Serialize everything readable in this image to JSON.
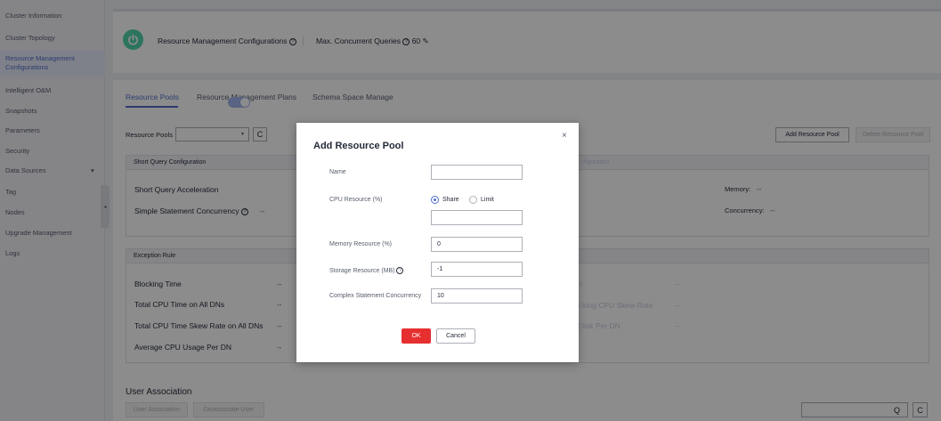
{
  "sidebar": {
    "items": [
      {
        "label": "Cluster Information"
      },
      {
        "label": "Cluster Topology"
      },
      {
        "label": "Resource Management"
      },
      {
        "label": "Configurations"
      },
      {
        "label": "Intelligent O&M"
      },
      {
        "label": "Snapshots"
      },
      {
        "label": "Parameters"
      },
      {
        "label": "Security"
      },
      {
        "label": "Data Sources"
      },
      {
        "label": "Tag"
      },
      {
        "label": "Nodes"
      },
      {
        "label": "Upgrade Management"
      },
      {
        "label": "Logs"
      }
    ],
    "data_sources_arrow": "▾",
    "collapse_arrow": "◂"
  },
  "top": {
    "rm_config_label": "Resource Management Configurations",
    "max_queries_label": "Max. Concurrent Queries",
    "max_queries_value": "60",
    "help_glyph": "?",
    "edit_glyph": "✎"
  },
  "tabs": [
    {
      "label": "Resource Pools"
    },
    {
      "label": "Resource Management Plans"
    },
    {
      "label": "Schema Space Manage"
    }
  ],
  "pools": {
    "label": "Resource Pools",
    "select_caret": "▾",
    "refresh_glyph": "C",
    "add_button": "Add Resource Pool",
    "delete_button": "Delete Resource Pool"
  },
  "short_query": {
    "header": "Short Query Configuration",
    "acceleration_label": "Short Query Acceleration",
    "simple_concurrency_label": "Simple Statement Concurrency",
    "simple_concurrency_value": "--"
  },
  "right_config": {
    "header": "nfiguration",
    "dash1": "--",
    "dash2": "--",
    "memory_label": "Memory:",
    "memory_value": "--",
    "concurrency_label": "Concurrency:",
    "concurrency_value": "--"
  },
  "exception": {
    "header": "Exception Rule",
    "rows": [
      {
        "label": "Blocking Time",
        "value": "--"
      },
      {
        "label": "Total CPU Time on All DNs",
        "value": "--"
      },
      {
        "label": "Total CPU Time Skew Rate on All DNs",
        "value": "--"
      },
      {
        "label": "Average CPU Usage Per DN",
        "value": "--"
      }
    ],
    "right_rows": [
      {
        "label": "e",
        "value": "--"
      },
      {
        "label": "cking CPU Skew Rate",
        "value": "--"
      },
      {
        "label": "Disk Per DN",
        "value": "--"
      }
    ]
  },
  "user_association": {
    "title": "User Association",
    "assoc_button": "User Association",
    "disassoc_button": "Disassociate User",
    "search_glyph": "Q",
    "refresh_glyph": "C"
  },
  "modal": {
    "title": "Add Resource Pool",
    "close_glyph": "×",
    "fields": {
      "name_label": "Name",
      "name_value": "",
      "cpu_label": "CPU Resource (%)",
      "share_label": "Share",
      "limit_label": "Limit",
      "cpu_value": "",
      "memory_label": "Memory Resource (%)",
      "memory_value": "0",
      "storage_label": "Storage Resource (MB)",
      "storage_value": "-1",
      "complex_label": "Complex Statement Concurrency",
      "complex_value": "10"
    },
    "ok_label": "OK",
    "cancel_label": "Cancel"
  }
}
